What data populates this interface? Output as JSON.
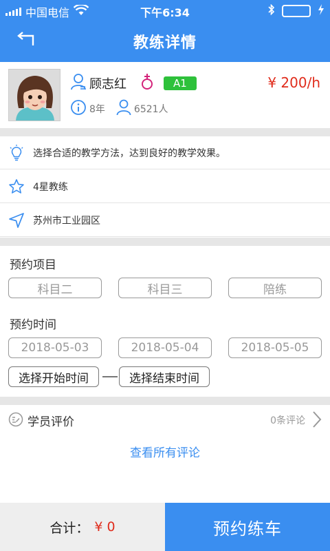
{
  "status_bar": {
    "carrier": "中国电信",
    "time": "下午6:34"
  },
  "header": {
    "title": "教练详情",
    "back_icon": "back-arrow-icon"
  },
  "coach": {
    "name": "顾志红",
    "license": "A1",
    "price": "¥ 200/h",
    "years": "8年",
    "students": "6521人",
    "colors": {
      "license_badge": "#2ec13b",
      "price": "#e02c1c"
    }
  },
  "info": {
    "motto": "选择合适的教学方法，达到良好的教学效果。",
    "rating": "4星教练",
    "location": "苏州市工业园区"
  },
  "booking": {
    "project_label": "预约项目",
    "projects": [
      "科目二",
      "科目三",
      "陪练"
    ],
    "time_label": "预约时间",
    "dates": [
      "2018-05-03",
      "2018-05-04",
      "2018-05-05"
    ],
    "start_time": "选择开始时间",
    "end_time": "选择结束时间"
  },
  "reviews": {
    "label": "学员评价",
    "count": "0条评论",
    "view_all": "查看所有评论"
  },
  "footer": {
    "total_label": "合计：",
    "total_amount": "¥ 0",
    "book_button": "预约练车"
  },
  "colors": {
    "accent": "#3a8ef0",
    "price": "#e02c1c"
  }
}
